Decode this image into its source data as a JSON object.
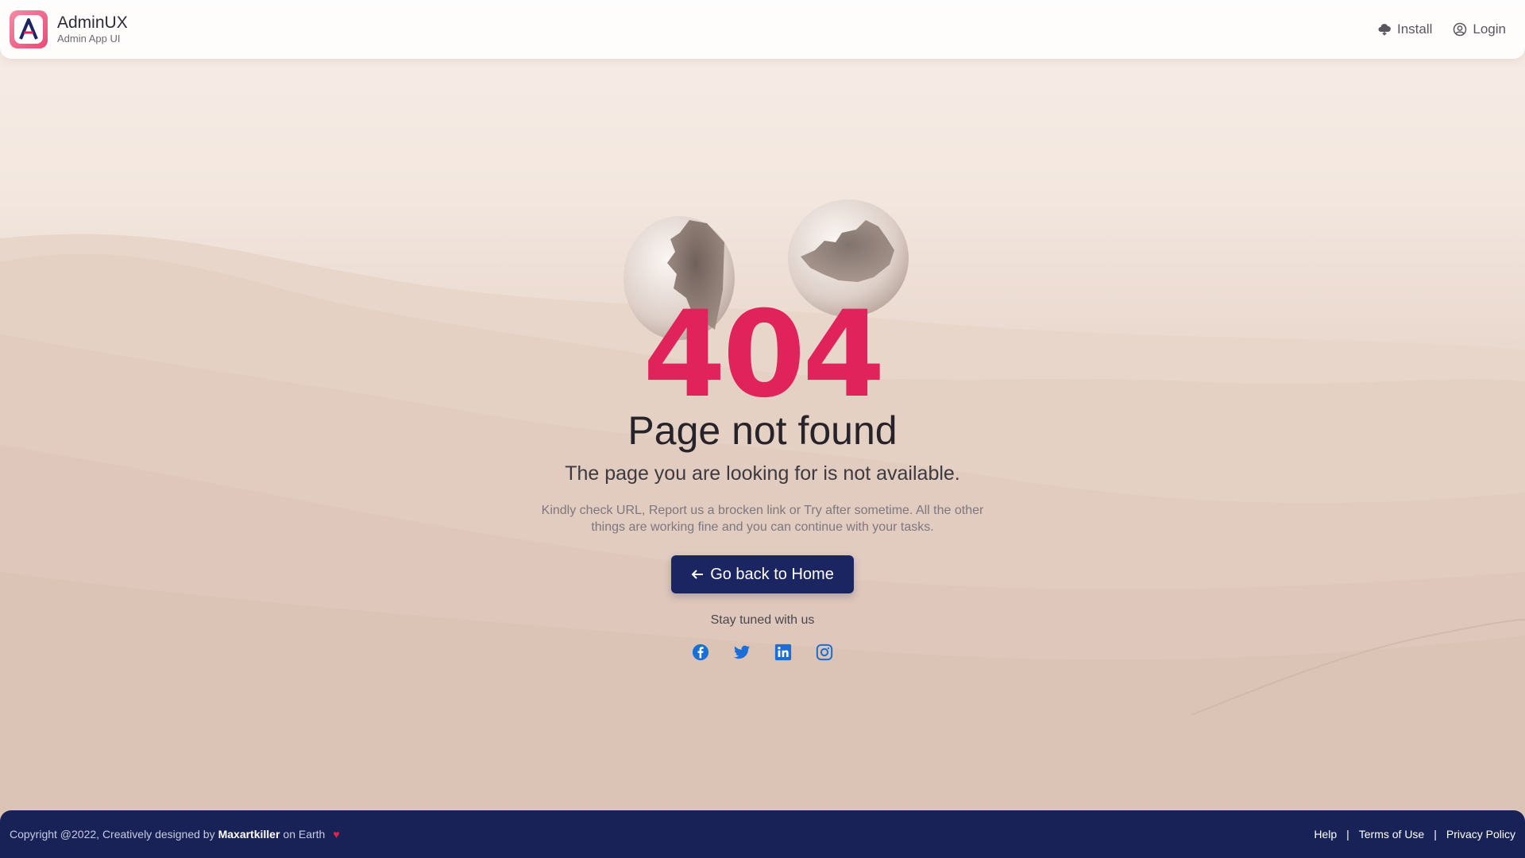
{
  "header": {
    "brand_title": "AdminUX",
    "brand_subtitle": "Admin App UI",
    "logo_letter": "A",
    "install_label": "Install",
    "login_label": "Login"
  },
  "error": {
    "code": "404",
    "title": "Page not found",
    "subtitle": "The page you are looking for is not available.",
    "description": "Kindly check URL, Report us a brocken link or Try after sometime. All the other things are working fine and you can continue with your tasks.",
    "button_label": "Go back to Home",
    "button_icon": "arrow-left-icon"
  },
  "social": {
    "heading": "Stay tuned with us",
    "items": [
      "facebook-icon",
      "twitter-icon",
      "linkedin-icon",
      "instagram-icon"
    ],
    "color": "#1a6fd6"
  },
  "footer": {
    "copyright_prefix": "Copyright @2022, Creatively designed by",
    "designer": "Maxartkiller",
    "suffix": "on Earth",
    "heart": "♥",
    "links": [
      "Help",
      "Terms of Use",
      "Privacy Policy"
    ],
    "separator": "|"
  },
  "colors": {
    "accent": "#e0235a",
    "primary": "#1a2561",
    "footer_bg": "#182257"
  }
}
